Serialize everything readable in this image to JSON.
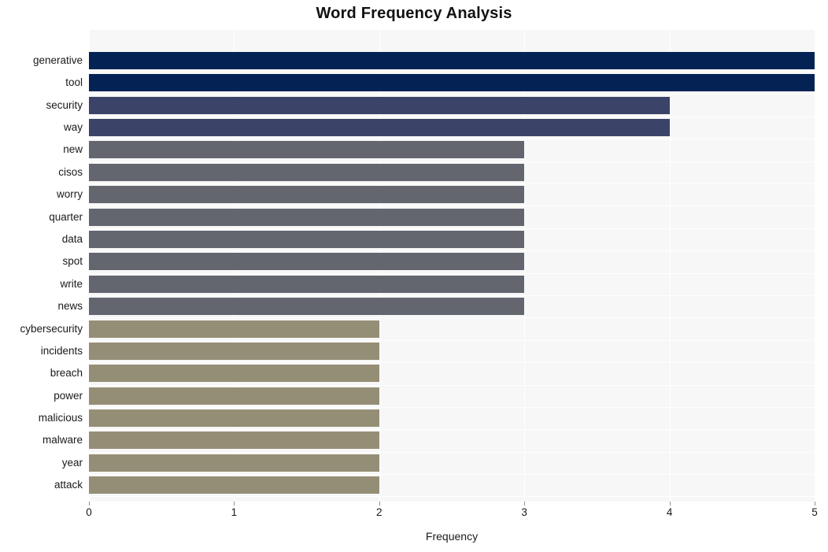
{
  "chart_data": {
    "type": "bar",
    "orientation": "horizontal",
    "title": "Word Frequency Analysis",
    "xlabel": "Frequency",
    "ylabel": "",
    "xlim": [
      0,
      5
    ],
    "xticks": [
      0,
      1,
      2,
      3,
      4,
      5
    ],
    "xtick_labels": [
      "0",
      "1",
      "2",
      "3",
      "4",
      "5"
    ],
    "grid": true,
    "legend": false,
    "categories": [
      "generative",
      "tool",
      "security",
      "way",
      "new",
      "cisos",
      "worry",
      "quarter",
      "data",
      "spot",
      "write",
      "news",
      "cybersecurity",
      "incidents",
      "breach",
      "power",
      "malicious",
      "malware",
      "year",
      "attack"
    ],
    "values": [
      5,
      5,
      4,
      4,
      3,
      3,
      3,
      3,
      3,
      3,
      3,
      3,
      2,
      2,
      2,
      2,
      2,
      2,
      2,
      2
    ],
    "bar_colors": [
      "#042354",
      "#042354",
      "#3b4468",
      "#3b4468",
      "#63666f",
      "#63666f",
      "#63666f",
      "#63666f",
      "#63666f",
      "#63666f",
      "#63666f",
      "#63666f",
      "#958e76",
      "#958e76",
      "#958e76",
      "#958e76",
      "#958e76",
      "#958e76",
      "#958e76",
      "#958e76"
    ],
    "plot_background": "#f7f7f7",
    "gridline_color": "#ffffff",
    "figure_background": "#ffffff"
  }
}
